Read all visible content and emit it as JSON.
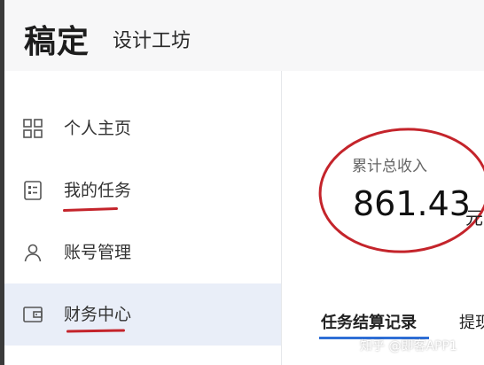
{
  "app": {
    "logo": "稿定",
    "product": "设计工坊"
  },
  "sidebar": {
    "items": [
      {
        "label": "个人主页",
        "icon": "grid-icon",
        "active": false
      },
      {
        "label": "我的任务",
        "icon": "task-list-icon",
        "active": false
      },
      {
        "label": "账号管理",
        "icon": "user-icon",
        "active": false
      },
      {
        "label": "财务中心",
        "icon": "wallet-icon",
        "active": true
      }
    ]
  },
  "main": {
    "stat": {
      "label": "累计总收入",
      "value": "861.43",
      "unit": "元"
    },
    "tabs": [
      {
        "label": "任务结算记录",
        "active": true
      },
      {
        "label": "提现",
        "active": false
      }
    ]
  },
  "watermark": "知乎 @即客APP1",
  "colors": {
    "accent": "#2f6fd6",
    "annotation_red": "#c4242b",
    "active_bg": "#e9eef8"
  }
}
